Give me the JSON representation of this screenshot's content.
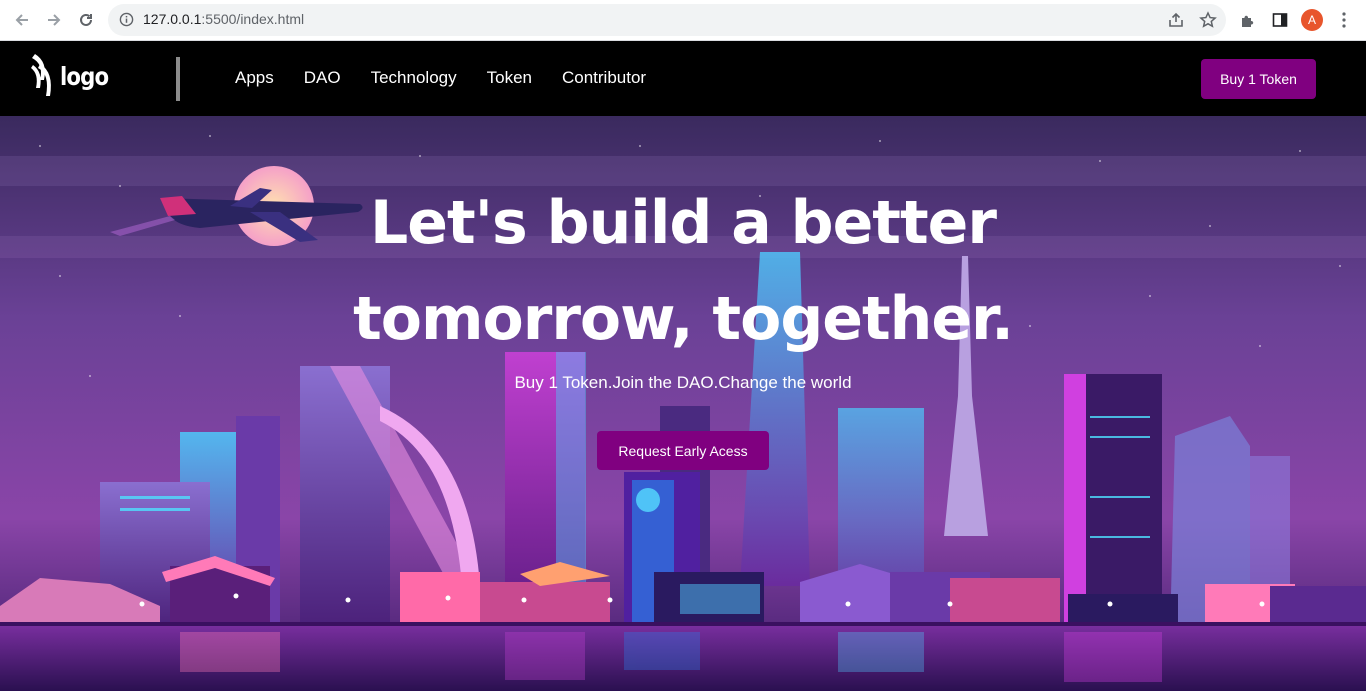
{
  "browser": {
    "url_host": "127.0.0.1",
    "url_rest": ":5500/index.html",
    "profile_initial": "A",
    "icons": [
      "back-icon",
      "forward-icon",
      "reload-icon",
      "info-icon",
      "share-icon",
      "star-icon",
      "extensions-icon",
      "side-panel-icon",
      "menu-icon"
    ]
  },
  "header": {
    "logo_text": "logo",
    "nav": [
      "Apps",
      "DAO",
      "Technology",
      "Token",
      "Contributor"
    ],
    "buy_label": "Buy 1 Token"
  },
  "hero": {
    "title_line1": "Let's build a better",
    "title_line2": "tomorrow, together.",
    "subtitle": "Buy 1 Token.Join the DAO.Change the world",
    "cta_label": "Request Early Acess"
  },
  "colors": {
    "accent": "#800080",
    "header_bg": "#000000",
    "hero_purple": "#6e3f98"
  }
}
